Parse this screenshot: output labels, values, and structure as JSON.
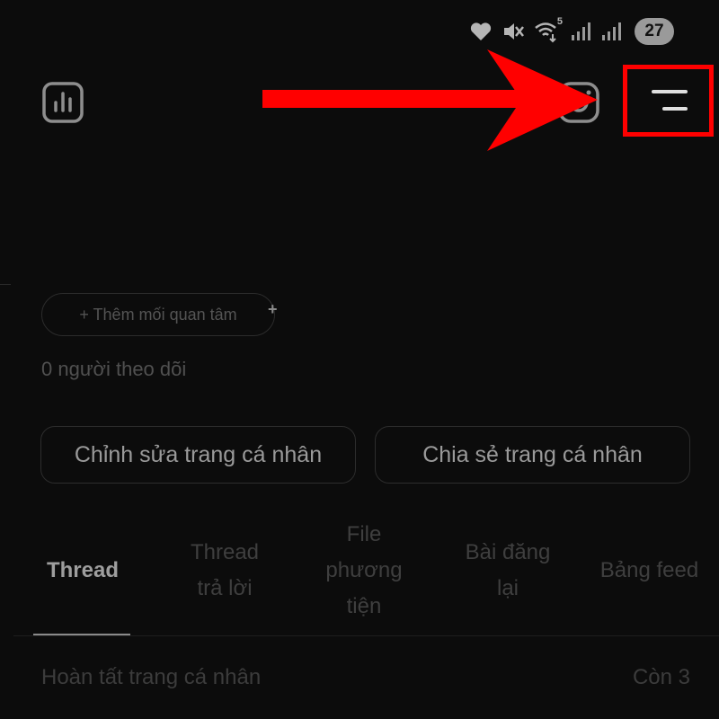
{
  "status_bar": {
    "icons": [
      "heart-icon",
      "mute-icon",
      "wifi-icon",
      "signal-icon",
      "signal-icon"
    ],
    "wifi_badge": "5",
    "battery": "27"
  },
  "header": {
    "icons": [
      "insights-icon",
      "instagram-icon",
      "menu-icon"
    ]
  },
  "annotation": {
    "arrow_color": "#ff0000",
    "highlight_color": "#ff0000"
  },
  "profile": {
    "interest_chip": "+ Thêm mối quan tâm",
    "chip_plus": "+",
    "followers": "0 người theo dõi",
    "edit_button": "Chỉnh sửa trang cá nhân",
    "share_button": "Chia sẻ trang cá nhân"
  },
  "tabs": [
    {
      "lines": [
        "Thread"
      ],
      "active": true
    },
    {
      "lines": [
        "Thread",
        "trả lời"
      ],
      "active": false
    },
    {
      "lines": [
        "File",
        "phương",
        "tiện"
      ],
      "active": false
    },
    {
      "lines": [
        "Bài đăng",
        "lại"
      ],
      "active": false
    },
    {
      "lines": [
        "Bảng feed"
      ],
      "active": false
    }
  ],
  "complete_profile": {
    "label": "Hoàn tất trang cá nhân",
    "remaining": "Còn 3"
  }
}
